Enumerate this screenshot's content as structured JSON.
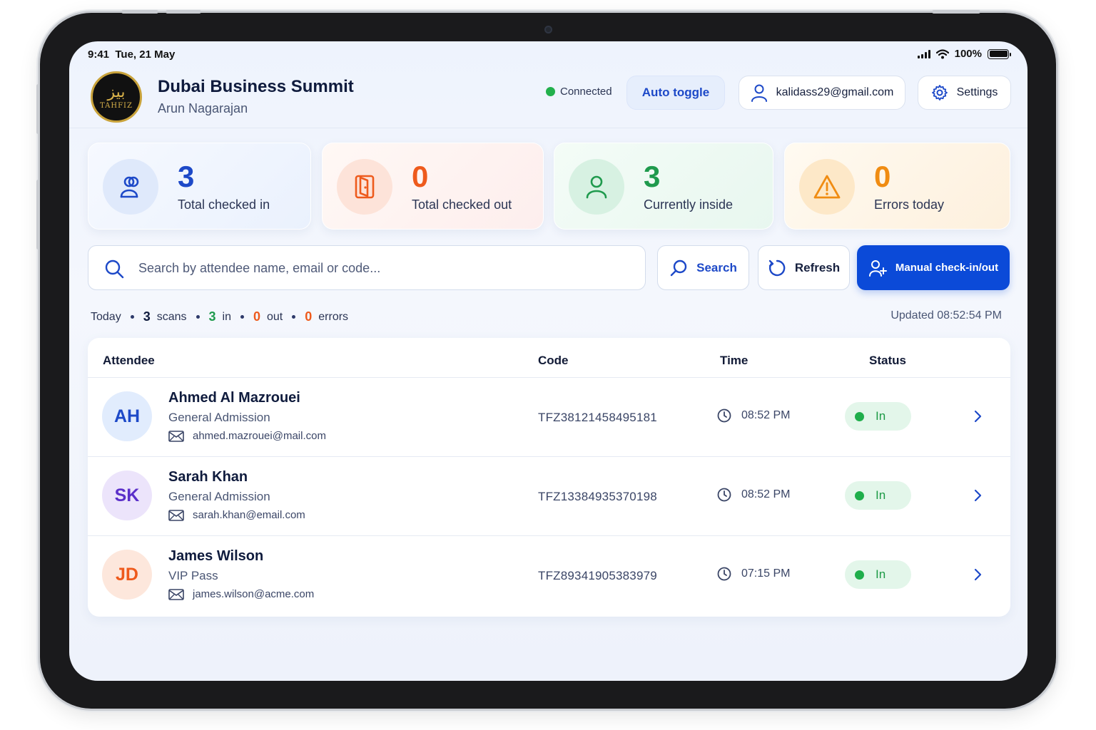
{
  "status_bar": {
    "time": "9:41",
    "date": "Tue, 21 May",
    "battery": "100%"
  },
  "header": {
    "logo_text": "TAHFIZ",
    "logo_glyph": "بيز",
    "event_title": "Dubai Business Summit",
    "event_owner": "Arun Nagarajan",
    "connection_status": "Connected",
    "auto_toggle_label": "Auto toggle",
    "user_email": "kalidass29@gmail.com",
    "settings_label": "Settings"
  },
  "stats": [
    {
      "value": "3",
      "label": "Total checked in",
      "icon": "users-icon",
      "color": "#1d49c8"
    },
    {
      "value": "0",
      "label": "Total checked out",
      "icon": "exit-door-icon",
      "color": "#ee5a1c"
    },
    {
      "value": "3",
      "label": "Currently inside",
      "icon": "user-icon",
      "color": "#1f9a4d"
    },
    {
      "value": "0",
      "label": "Errors today",
      "icon": "warning-icon",
      "color": "#f08c12"
    }
  ],
  "search": {
    "placeholder": "Search by attendee name, email or code...",
    "value": "",
    "search_label": "Search",
    "refresh_label": "Refresh",
    "manual_label": "Manual check-in/out"
  },
  "summary": {
    "today_label": "Today",
    "scans_count": "3",
    "scans_label": "scans",
    "in_count": "3",
    "in_label": "in",
    "out_count": "0",
    "out_label": "out",
    "errors_count": "0",
    "errors_label": "errors",
    "updated": "Updated 08:52:54 PM"
  },
  "table": {
    "columns": [
      "Attendee",
      "Code",
      "Time",
      "Status"
    ],
    "rows": [
      {
        "initials": "AH",
        "name": "Ahmed Al Mazrouei",
        "type": "General Admission",
        "email": "ahmed.mazrouei@mail.com",
        "code": "TFZ38121458495181",
        "time": "08:52 PM",
        "status": "In",
        "avatar_bg": "#e1ecfd",
        "avatar_fg": "#1d49c8"
      },
      {
        "initials": "SK",
        "name": "Sarah Khan",
        "type": "General Admission",
        "email": "sarah.khan@email.com",
        "code": "TFZ13384935370198",
        "time": "08:52 PM",
        "status": "In",
        "avatar_bg": "#ece4fb",
        "avatar_fg": "#5b2fc9"
      },
      {
        "initials": "JD",
        "name": "James Wilson",
        "type": "VIP Pass",
        "email": "james.wilson@acme.com",
        "code": "TFZ89341905383979",
        "time": "07:15 PM",
        "status": "In",
        "avatar_bg": "#fde7dc",
        "avatar_fg": "#ee5a1c"
      }
    ]
  }
}
